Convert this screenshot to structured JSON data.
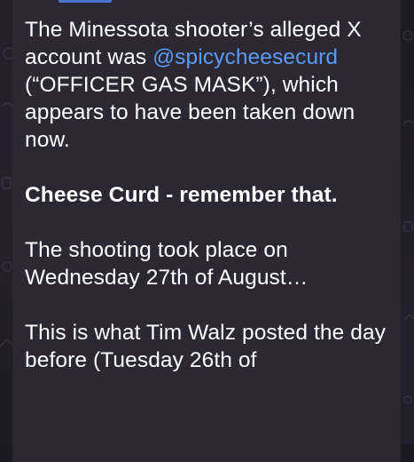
{
  "message": {
    "paragraph1": {
      "before_link": "The Minessota shooter’s alleged X account was ",
      "link": "@spicycheesecurd",
      "after_link": " (“OFFICER GAS MASK”), which appears to have been taken down now."
    },
    "paragraph2": "Cheese Curd - remember that.",
    "paragraph3": "The shooting took place on Wednesday 27th of August…",
    "paragraph4": "This is what Tim Walz posted the day before (Tuesday 26th of"
  },
  "colors": {
    "bubble": "#2b2833",
    "link": "#5b9cf2",
    "text": "#ffffff",
    "accent_bar": "#4a74c9"
  }
}
